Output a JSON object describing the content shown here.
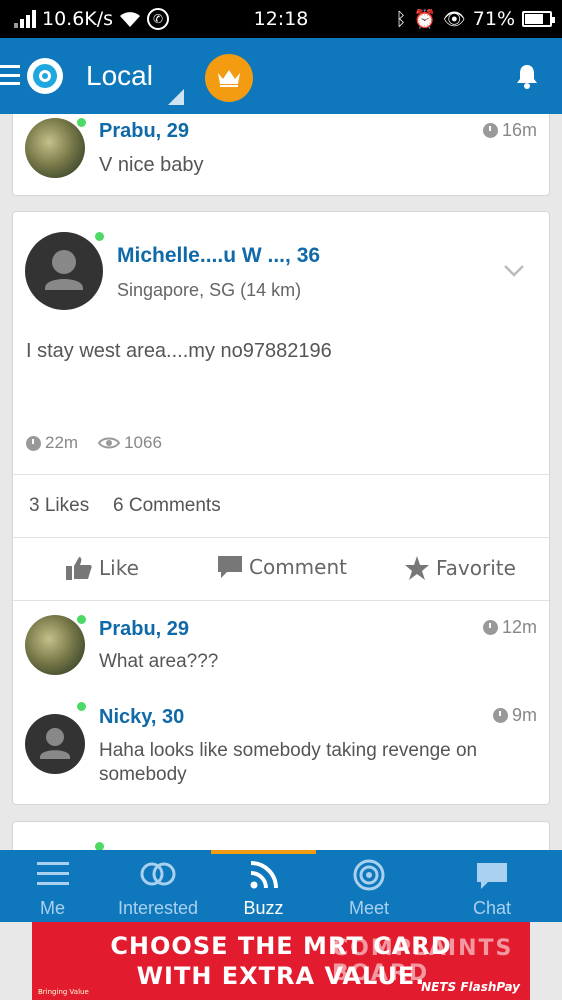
{
  "status_bar": {
    "network_speed": "10.6K/s",
    "time": "12:18",
    "battery": "71%"
  },
  "header": {
    "title": "Local"
  },
  "top_post": {
    "name": "Prabu, 29",
    "text": "V nice baby",
    "time": "16m"
  },
  "main_post": {
    "author": "Michelle....u W ..., 36",
    "location": "Singapore, SG",
    "distance": "(14 km)",
    "text": "I stay west area....my no97882196",
    "age": "22m",
    "views": "1066",
    "likes": "3 Likes",
    "comments": "6 Comments",
    "actions": {
      "like": "Like",
      "comment": "Comment",
      "favorite": "Favorite"
    }
  },
  "comments": [
    {
      "name": "Prabu, 29",
      "text": "What area???",
      "time": "12m"
    },
    {
      "name": "Nicky, 30",
      "text": "Haha looks like somebody taking revenge on somebody",
      "time": "9m"
    }
  ],
  "nav": {
    "me": "Me",
    "interested": "Interested",
    "buzz": "Buzz",
    "meet": "Meet",
    "chat": "Chat",
    "active": "Buzz"
  },
  "ad": {
    "line1": "CHOOSE THE MRT CARD",
    "line2": "WITH EXTRA VALUE.",
    "brand": "NETS FlashPay",
    "watermark": "COMPLAINTS BOARD",
    "tagline": "Bringing Value"
  },
  "colors": {
    "primary": "#0f78bd",
    "accent": "#f39c12",
    "name_blue": "#0f6aa7",
    "online": "#4cd964"
  }
}
